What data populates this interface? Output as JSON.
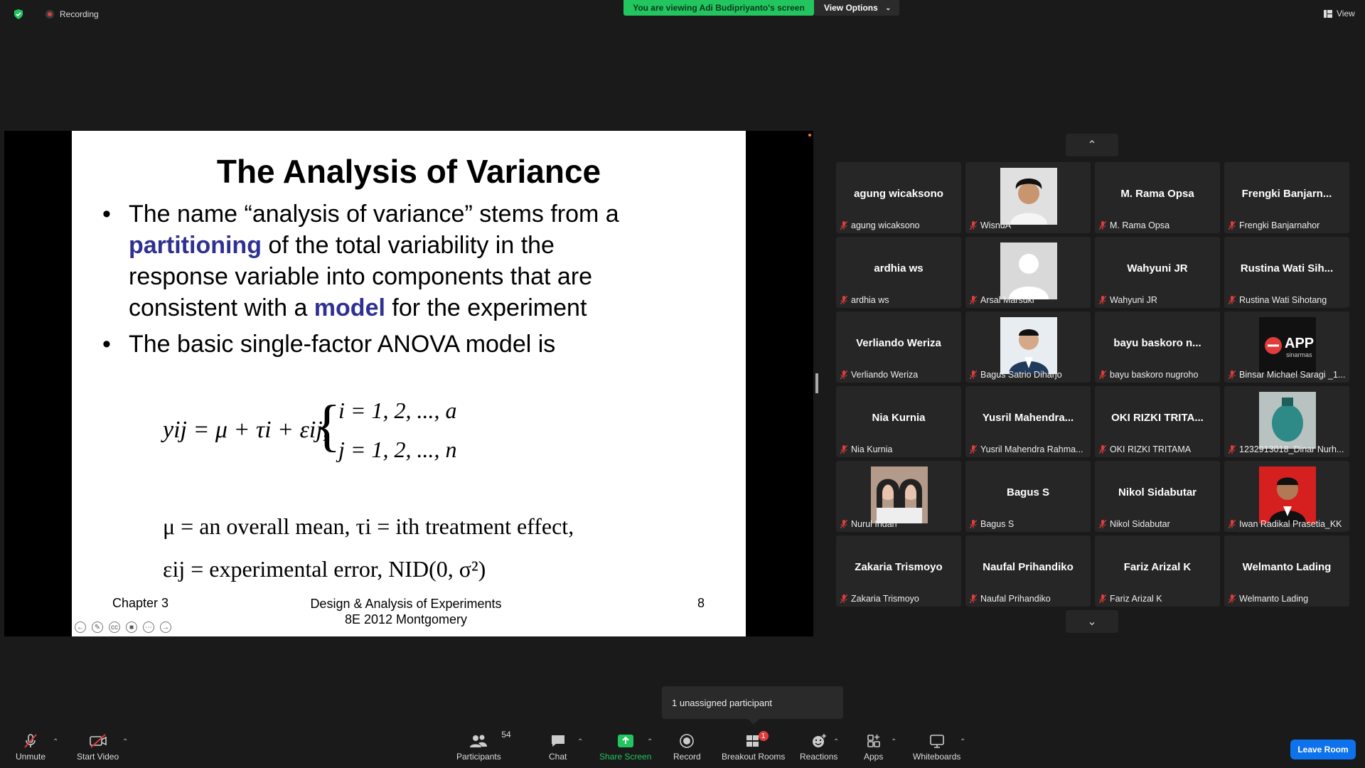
{
  "topbar": {
    "recording_label": "Recording",
    "viewing_banner": "You are viewing Adi Budipriyanto's screen",
    "view_options_label": "View Options",
    "view_label": "View"
  },
  "slide": {
    "title": "The Analysis of Variance",
    "bullet1_part1": "The name “analysis of variance” stems from a",
    "bullet1_kw1": "partitioning",
    "bullet1_part2": " of the total variability in the",
    "bullet1_line3": "response variable into components that are",
    "bullet1_part4": "consistent with a ",
    "bullet1_kw2": "model",
    "bullet1_part5": " for the experiment",
    "bullet2": "The basic single-factor ANOVA model is",
    "eq_model": "yij = μ + τi + εij,",
    "eq_i": "i = 1, 2, ..., a",
    "eq_j": "j = 1, 2, ..., n",
    "def1": "μ =  an overall mean,  τi = ith treatment effect,",
    "def2": "εij =  experimental error, NID(0, σ²)",
    "footer_left": "Chapter 3",
    "footer_mid_1": "Design & Analysis of Experiments",
    "footer_mid_2": "8E 2012 Montgomery",
    "footer_num": "8"
  },
  "gallery": {
    "tiles": [
      {
        "name": "agung wicaksono",
        "label": "agung wicaksono",
        "photo": ""
      },
      {
        "name": "",
        "label": "WisnuA",
        "photo": "person-curly"
      },
      {
        "name": "M. Rama Opsa",
        "label": "M. Rama Opsa",
        "photo": ""
      },
      {
        "name": "Frengki  Banjarn...",
        "label": "Frengki Banjarnahor",
        "photo": ""
      },
      {
        "name": "ardhia ws",
        "label": "ardhia ws",
        "photo": ""
      },
      {
        "name": "",
        "label": "Arsal Marsuki",
        "photo": "default-avatar"
      },
      {
        "name": "Wahyuni JR",
        "label": "Wahyuni JR",
        "photo": ""
      },
      {
        "name": "Rustina Wati Sih...",
        "label": "Rustina Wati Sihotang",
        "photo": ""
      },
      {
        "name": "Verliando Weriza",
        "label": "Verliando Weriza",
        "photo": ""
      },
      {
        "name": "",
        "label": "Bagus Satrio Diharjo",
        "photo": "person-suit"
      },
      {
        "name": "bayu baskoro n...",
        "label": "bayu baskoro nugroho",
        "photo": ""
      },
      {
        "name": "",
        "label": "Binsar Michael Saragi _1...",
        "photo": "app-logo"
      },
      {
        "name": "Nia Kurnia",
        "label": "Nia Kurnia",
        "photo": ""
      },
      {
        "name": "Yusril  Mahendra...",
        "label": "Yusril Mahendra Rahma...",
        "photo": ""
      },
      {
        "name": "OKI RIZKI TRITA...",
        "label": "OKI RIZKI TRITAMA",
        "photo": ""
      },
      {
        "name": "",
        "label": "1232913018_Dinar Nurh...",
        "photo": "object-teal"
      },
      {
        "name": "",
        "label": "Nurul Indah",
        "photo": "two-people"
      },
      {
        "name": "Bagus S",
        "label": "Bagus S",
        "photo": ""
      },
      {
        "name": "Nikol Sidabutar",
        "label": "Nikol Sidabutar",
        "photo": ""
      },
      {
        "name": "",
        "label": "Iwan Radikal Prasetia_KK",
        "photo": "person-red"
      },
      {
        "name": "Zakaria Trismoyo",
        "label": "Zakaria Trismoyo",
        "photo": ""
      },
      {
        "name": "Naufal Prihandiko",
        "label": "Naufal Prihandiko",
        "photo": ""
      },
      {
        "name": "Fariz Arizal K",
        "label": "Fariz Arizal K",
        "photo": ""
      },
      {
        "name": "Welmanto Lading",
        "label": "Welmanto Lading",
        "photo": ""
      }
    ],
    "app_logo_text": "APP",
    "app_logo_sub": "sinarmas"
  },
  "popup": {
    "text": "1 unassigned participant"
  },
  "toolbar": {
    "unmute": "Unmute",
    "start_video": "Start Video",
    "participants": "Participants",
    "participants_count": "54",
    "chat": "Chat",
    "share_screen": "Share Screen",
    "record": "Record",
    "breakout_rooms": "Breakout Rooms",
    "breakout_badge": "1",
    "reactions": "Reactions",
    "apps": "Apps",
    "whiteboards": "Whiteboards",
    "leave_room": "Leave Room",
    "share_color": "#22c55e",
    "leave_color": "#0e72ed"
  }
}
